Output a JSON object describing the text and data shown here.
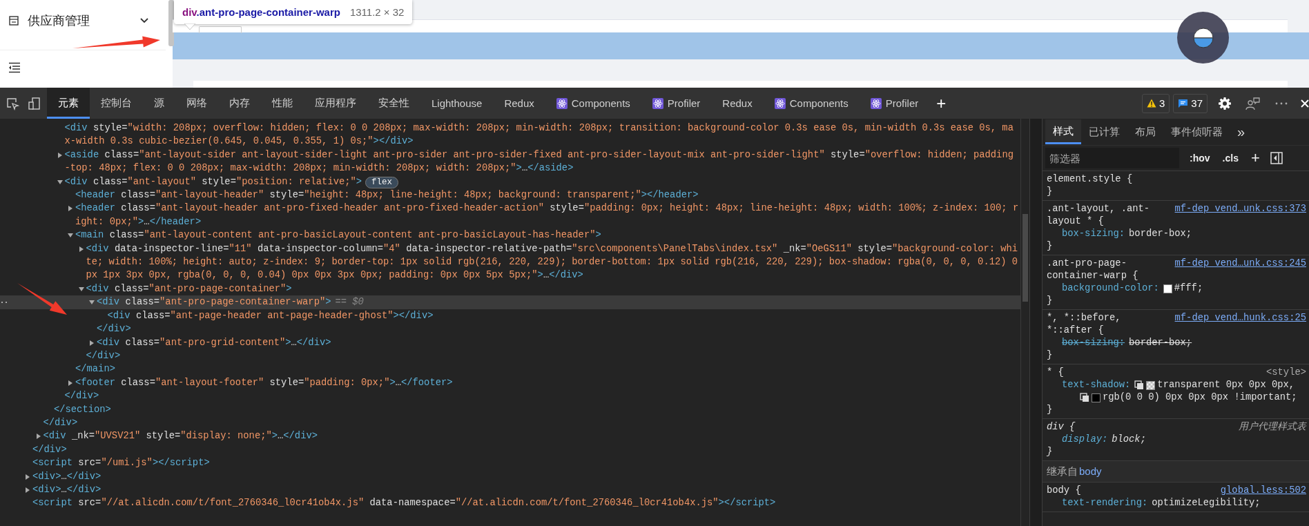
{
  "page": {
    "sidebar": {
      "menu_item": {
        "label": "供应商管理"
      }
    },
    "tooltip": {
      "tag": "div",
      "classes": ".ant-pro-page-container-warp",
      "size": "1311.2 × 32"
    }
  },
  "devtools": {
    "tabs": [
      {
        "label": "元素",
        "kind": "builtin",
        "selected": true
      },
      {
        "label": "控制台",
        "kind": "builtin",
        "selected": false
      },
      {
        "label": "源",
        "kind": "builtin",
        "selected": false
      },
      {
        "label": "网络",
        "kind": "builtin",
        "selected": false
      },
      {
        "label": "内存",
        "kind": "builtin",
        "selected": false
      },
      {
        "label": "性能",
        "kind": "builtin",
        "selected": false
      },
      {
        "label": "应用程序",
        "kind": "builtin",
        "selected": false
      },
      {
        "label": "安全性",
        "kind": "builtin",
        "selected": false
      },
      {
        "label": "Lighthouse",
        "kind": "builtin",
        "selected": false
      },
      {
        "label": "Redux",
        "kind": "builtin",
        "selected": false
      },
      {
        "label": "Components",
        "kind": "extension",
        "selected": false
      },
      {
        "label": "Profiler",
        "kind": "extension",
        "selected": false
      },
      {
        "label": "Redux",
        "kind": "builtin",
        "selected": false
      },
      {
        "label": "Components",
        "kind": "extension",
        "selected": false
      },
      {
        "label": "Profiler",
        "kind": "extension",
        "selected": false
      }
    ],
    "add_tab": "+",
    "warnings": "3",
    "messages": "37"
  },
  "elements_tree": [
    {
      "children": [
        {
          "children": [
            {
              "children": [
                {
                  "markup": "<div style=\"width: 208px; overflow: hidden; flex: 0 0 208px; max-width: 208px; min-width: 208px; transition: background-color 0.3s ease 0s, min-width 0.3s ease 0s, max-width 0.3s cubic-bezier(0.645, 0.045, 0.355, 1) 0s;\"></div>",
                  "selected": false
                },
                {
                  "markup": "<aside class=\"ant-layout-sider ant-layout-sider-light ant-pro-sider ant-pro-sider-fixed ant-pro-sider-layout-mix ant-pro-sider-light\" style=\"overflow: hidden; padding-top: 48px; flex: 0 0 208px; max-width: 208px; min-width: 208px; width: 208px;\">…</aside>",
                  "expanded": false,
                  "selected": false
                },
                {
                  "markup": "<div class=\"ant-layout\" style=\"position: relative;\">",
                  "badge": "flex",
                  "expanded": true,
                  "selected": false,
                  "close": "</div>",
                  "children": [
                    {
                      "markup": "<header class=\"ant-layout-header\" style=\"height: 48px; line-height: 48px; background: transparent;\"></header>",
                      "selected": false
                    },
                    {
                      "markup": "<header class=\"ant-layout-header ant-pro-fixed-header ant-pro-fixed-header-action\" style=\"padding: 0px; height: 48px; line-height: 48px; width: 100%; z-index: 100; right: 0px;\">…</header>",
                      "expanded": false,
                      "selected": false
                    },
                    {
                      "markup": "<main class=\"ant-layout-content ant-pro-basicLayout-content ant-pro-basicLayout-has-header\">",
                      "expanded": true,
                      "selected": false,
                      "close": "</main>",
                      "children": [
                        {
                          "markup": "<div data-inspector-line=\"11\" data-inspector-column=\"4\" data-inspector-relative-path=\"src\\components\\PanelTabs\\index.tsx\" _nk=\"OeGS11\" style=\"background-color: white; width: 100%; height: auto; z-index: 9; border-top: 1px solid rgb(216, 220, 229); border-bottom: 1px solid rgb(216, 220, 229); box-shadow: rgba(0, 0, 0, 0.12) 0px 1px 3px 0px, rgba(0, 0, 0, 0.04) 0px 0px 3px 0px; padding: 0px 0px 5px 5px;\">…</div>",
                          "expanded": false,
                          "selected": false
                        },
                        {
                          "markup": "<div class=\"ant-pro-page-container\">",
                          "expanded": true,
                          "selected": false,
                          "close": "</div>",
                          "children": [
                            {
                              "markup": "<div class=\"ant-pro-page-container-warp\">",
                              "suffix": "== $0",
                              "expanded": true,
                              "selected": true,
                              "close": "</div>",
                              "children": [
                                {
                                  "markup": "<div class=\"ant-page-header ant-page-header-ghost\"></div>",
                                  "selected": false
                                }
                              ]
                            },
                            {
                              "markup": "<div class=\"ant-pro-grid-content\">…</div>",
                              "expanded": false,
                              "selected": false
                            }
                          ]
                        }
                      ]
                    },
                    {
                      "markup": "<footer class=\"ant-layout-footer\" style=\"padding: 0px;\">…</footer>",
                      "expanded": false,
                      "selected": false
                    }
                  ]
                }
              ],
              "close": "</section>"
            }
          ],
          "close": "</div>"
        },
        {
          "markup": "<div _nk=\"UVSV21\" style=\"display: none;\">…</div>",
          "expanded": false,
          "selected": false
        }
      ],
      "close": "</div>"
    },
    {
      "markup": "<script src=\"/umi.js\"></script>",
      "selected": false
    },
    {
      "markup": "<div>…</div>",
      "expanded": false,
      "selected": false
    },
    {
      "markup": "<div>…</div>",
      "expanded": false,
      "selected": false
    },
    {
      "markup": "<script src=\"//at.alicdn.com/t/font_2760346_l0cr41ob4x.js\" data-namespace=\"//at.alicdn.com/t/font_2760346_l0cr41ob4x.js\"></script>",
      "selected": false
    }
  ],
  "styles": {
    "tabs": [
      {
        "label": "样式",
        "selected": true
      },
      {
        "label": "已计算",
        "selected": false
      },
      {
        "label": "布局",
        "selected": false
      },
      {
        "label": "事件侦听器",
        "selected": false
      }
    ],
    "more": "»",
    "filter": {
      "placeholder": "筛选器"
    },
    "hov": ":hov",
    "cls": ".cls",
    "new_rule": "+",
    "rules": [
      {
        "kind": "author",
        "selector": "element.style {",
        "close": "}"
      },
      {
        "kind": "author",
        "selector": ".ant-layout, .ant-layout * {",
        "source": "mf-dep_vend…unk.css:373",
        "props": [
          {
            "name": "box-sizing:",
            "overridden": false,
            "parts": [
              {
                "text": "border-box;"
              }
            ]
          }
        ],
        "close": "}"
      },
      {
        "kind": "author",
        "selector": ".ant-pro-page-container-warp {",
        "source": "mf-dep_vend…unk.css:245",
        "props": [
          {
            "name": "background-color:",
            "overridden": false,
            "parts": [
              {
                "swatch": true,
                "color": "#ffffff",
                "text": "#fff;"
              }
            ]
          }
        ],
        "close": "}"
      },
      {
        "kind": "author",
        "selector": "*, *::before, *::after {",
        "source": "mf-dep_vend…hunk.css:25",
        "props": [
          {
            "name": "box-sizing:",
            "overridden": true,
            "parts": [
              {
                "text": "border-box;"
              }
            ]
          }
        ],
        "close": "}"
      },
      {
        "kind": "inline",
        "selector": "* {",
        "source": "<style>",
        "props": [
          {
            "name": "text-shadow:",
            "overridden": false,
            "parts": [
              {
                "shadow": true,
                "swatch": true,
                "text": "transparent 0px 0px 0px,"
              },
              {
                "shadow": true,
                "swatch": true,
                "color": "#000000",
                "text": "rgb(0 0 0) 0px 0px 0px !important;"
              }
            ]
          }
        ],
        "close": "}"
      },
      {
        "kind": "user-agent",
        "selector": "div {",
        "source": "用户代理样式表",
        "props": [
          {
            "name": "display:",
            "overridden": false,
            "parts": [
              {
                "text": "block;"
              }
            ]
          }
        ],
        "close": "}"
      },
      {
        "kind": "inherited",
        "label": "继承自",
        "element": "body"
      },
      {
        "kind": "author",
        "selector": "body {",
        "source": "global.less:502",
        "props": [
          {
            "name": "text-rendering:",
            "overridden": false,
            "parts": [
              {
                "text": "optimizeLegibility;"
              }
            ]
          }
        ]
      }
    ]
  }
}
